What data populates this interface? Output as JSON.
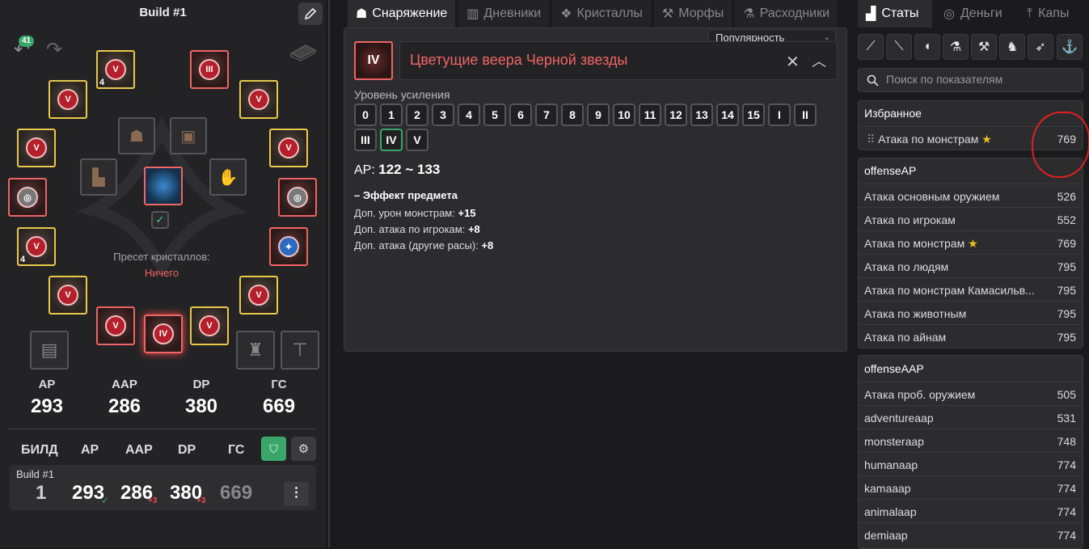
{
  "left": {
    "title": "Build #1",
    "undo_count": "41",
    "gear_slots": [
      {
        "id": "helmet",
        "enh": "V",
        "qty": "4"
      },
      {
        "id": "ring1",
        "enh": "III"
      },
      {
        "id": "earring1",
        "enh": "V"
      },
      {
        "id": "earring2",
        "enh": "V"
      },
      {
        "id": "necklace1",
        "enh": "V"
      },
      {
        "id": "ring2",
        "enh": "V"
      },
      {
        "id": "belt",
        "enh": ""
      },
      {
        "id": "shoes",
        "enh": ""
      },
      {
        "id": "gloves",
        "enh": "V",
        "qty": "4"
      },
      {
        "id": "mainweapon",
        "enh": ""
      },
      {
        "id": "offhand",
        "enh": "V"
      },
      {
        "id": "awakening",
        "enh": "V"
      },
      {
        "id": "armor",
        "enh": "V"
      },
      {
        "id": "necklace",
        "enh": "IV"
      },
      {
        "id": "artifact",
        "enh": "V"
      },
      {
        "id": "alchemy",
        "enh": "V"
      }
    ],
    "preset_label": "Пресет кристаллов:",
    "preset_value": "Ничего",
    "stats": [
      {
        "label": "AP",
        "value": "293"
      },
      {
        "label": "AAP",
        "value": "286"
      },
      {
        "label": "DP",
        "value": "380"
      },
      {
        "label": "ГС",
        "value": "669"
      }
    ],
    "build_table": {
      "headers": [
        "БИЛД",
        "AP",
        "AAP",
        "DP",
        "ГС"
      ],
      "row": {
        "name": "Build #1",
        "number": "1",
        "ap": "293",
        "aap": "286",
        "aap_plus": "+3",
        "dp": "380",
        "dp_plus": "+3",
        "gs": "669"
      }
    }
  },
  "middle": {
    "tabs": [
      "Снаряжение",
      "Дневники",
      "Кристаллы",
      "Морфы",
      "Расходники"
    ],
    "sort": "Популярность",
    "item_enh": "IV",
    "item_name": "Цветущие веера Черной звезды",
    "level_label": "Уровень усиления",
    "levels": [
      "0",
      "1",
      "2",
      "3",
      "4",
      "5",
      "6",
      "7",
      "8",
      "9",
      "10",
      "11",
      "12",
      "13",
      "14",
      "15",
      "I",
      "II",
      "III",
      "IV",
      "V"
    ],
    "selected_level": "IV",
    "ap_label": "AP:",
    "ap_value": "122 ~ 133",
    "effect_title": "– Эффект предмета",
    "effects": [
      {
        "label": "Доп. урон монстрам:",
        "value": "+15"
      },
      {
        "label": "Доп. атака по игрокам:",
        "value": "+8"
      },
      {
        "label": "Доп. атака (другие расы):",
        "value": "+8"
      }
    ]
  },
  "right": {
    "tabs": [
      "Статы",
      "Деньги",
      "Капы"
    ],
    "class_icons": [
      "sword-icon",
      "dagger-icon",
      "fish-icon",
      "flask-icon",
      "hammer-icon",
      "horse-icon",
      "bird-icon",
      "anchor-icon"
    ],
    "search_placeholder": "Поиск по показателям",
    "favorites": {
      "title": "Избранное",
      "rows": [
        {
          "label": "Атака по монстрам",
          "value": "769",
          "star": true
        }
      ]
    },
    "offenseAP": {
      "title": "offenseAP",
      "rows": [
        {
          "label": "Атака основным оружием",
          "value": "526"
        },
        {
          "label": "Атака по игрокам",
          "value": "552"
        },
        {
          "label": "Атака по монстрам",
          "value": "769",
          "star": true
        },
        {
          "label": "Атака по людям",
          "value": "795"
        },
        {
          "label": "Атака по монстрам Камасильв...",
          "value": "795"
        },
        {
          "label": "Атака по животным",
          "value": "795"
        },
        {
          "label": "Атака по айнам",
          "value": "795"
        }
      ]
    },
    "offenseAAP": {
      "title": "offenseAAP",
      "rows": [
        {
          "label": "Атака проб. оружием",
          "value": "505"
        },
        {
          "label": "adventureaap",
          "value": "531"
        },
        {
          "label": "monsteraap",
          "value": "748"
        },
        {
          "label": "humanaap",
          "value": "774"
        },
        {
          "label": "kamaaap",
          "value": "774"
        },
        {
          "label": "animalaap",
          "value": "774"
        },
        {
          "label": "demiaap",
          "value": "774"
        }
      ]
    }
  }
}
